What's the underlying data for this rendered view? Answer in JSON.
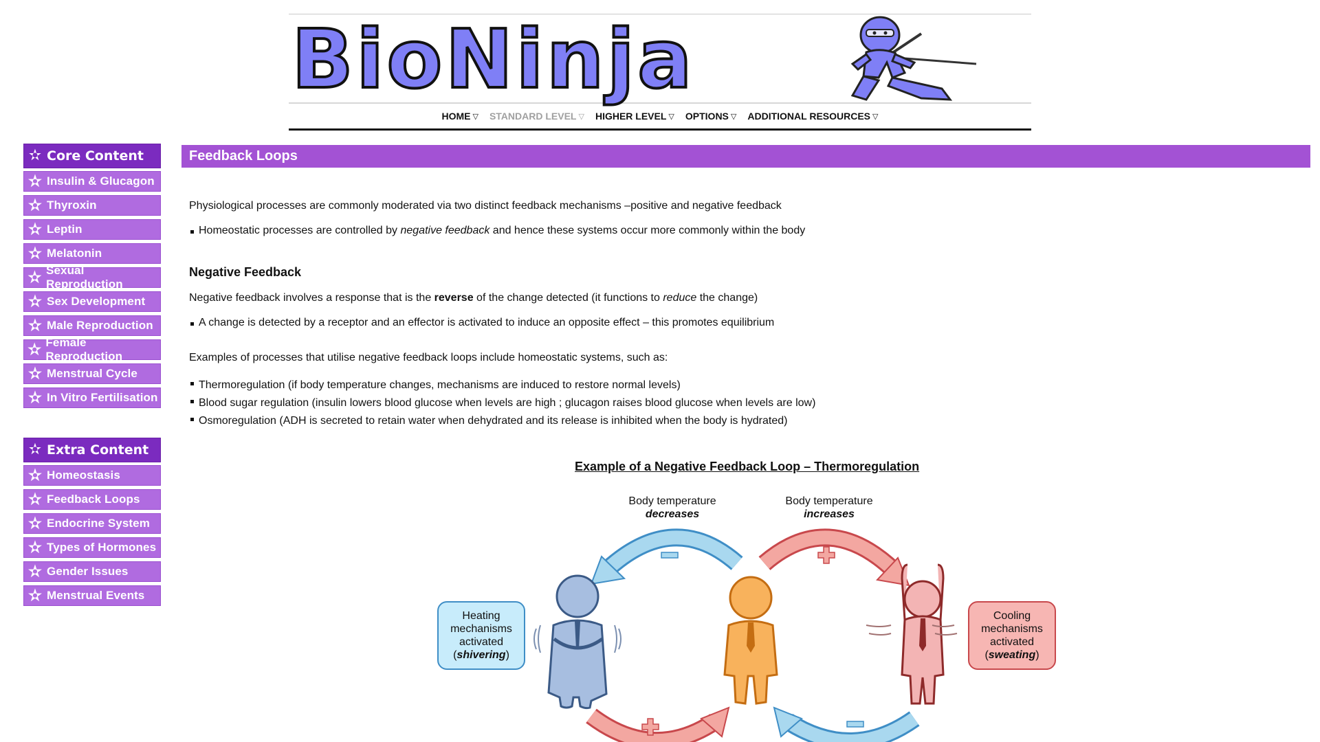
{
  "header": {
    "logo_text": "BioNinja",
    "nav": [
      {
        "label": "HOME",
        "dim": false
      },
      {
        "label": "STANDARD LEVEL",
        "dim": true
      },
      {
        "label": "HIGHER LEVEL",
        "dim": false
      },
      {
        "label": "OPTIONS",
        "dim": false
      },
      {
        "label": "ADDITIONAL RESOURCES",
        "dim": false
      }
    ],
    "nav_arrow": "▽"
  },
  "sidebar": {
    "core_title": "Core Content",
    "core_items": [
      "Insulin & Glucagon",
      "Thyroxin",
      "Leptin",
      "Melatonin",
      "Sexual Reproduction",
      "Sex Development",
      "Male Reproduction",
      "Female Reproduction",
      "Menstrual Cycle",
      "In Vitro Fertilisation"
    ],
    "extra_title": "Extra Content",
    "extra_items": [
      "Homeostasis",
      "Feedback Loops",
      "Endocrine System",
      "Types of Hormones",
      "Gender Issues",
      "Menstrual Events"
    ],
    "star_icon": "✫"
  },
  "main": {
    "title": "Feedback Loops",
    "intro": "Physiological processes are commonly moderated via two distinct feedback mechanisms –positive and negative feedback",
    "intro_bullet": {
      "a": "Homeostatic processes are controlled by ",
      "em": "negative feedback",
      "b": " and hence these systems occur more commonly within the body"
    },
    "neg_heading": "Negative Feedback",
    "neg_desc": {
      "a": "Negative feedback involves a response that is the ",
      "strong": "reverse",
      "b": " of the change detected (it functions to ",
      "em": "reduce",
      "c": " the change)"
    },
    "neg_bullet": "A change is detected by a receptor and an effector is activated to induce an opposite effect – this promotes equilibrium",
    "examples_intro": "Examples of processes that utilise negative feedback loops include homeostatic systems, such as:",
    "examples": [
      "Thermoregulation (if body temperature changes, mechanisms are induced to restore normal levels)",
      "Blood sugar regulation (insulin lowers blood glucose when levels are high ; glucagon raises blood glucose when levels are low)",
      "Osmoregulation (ADH is secreted to retain water when dehydrated and its release is inhibited when the body is hydrated)"
    ]
  },
  "diagram": {
    "title": "Example of a Negative Feedback Loop – Thermoregulation",
    "left_top": {
      "line1": "Body temperature",
      "line2": "decreases"
    },
    "right_top": {
      "line1": "Body temperature",
      "line2": "increases"
    },
    "left_box": {
      "l1": "Heating",
      "l2": "mechanisms",
      "l3": "activated",
      "open": "(",
      "em": "shivering",
      "close": ")"
    },
    "right_box": {
      "l1": "Cooling",
      "l2": "mechanisms",
      "l3": "activated",
      "open": "(",
      "em": "sweating",
      "close": ")"
    },
    "colors": {
      "blue_arrow": "#a9d8ef",
      "red_arrow": "#f3a7a1",
      "left_box_fill": "#c8ecfb",
      "left_box_border": "#3f8ec6",
      "right_box_fill": "#f7b6b3",
      "right_box_border": "#c8484c"
    }
  }
}
